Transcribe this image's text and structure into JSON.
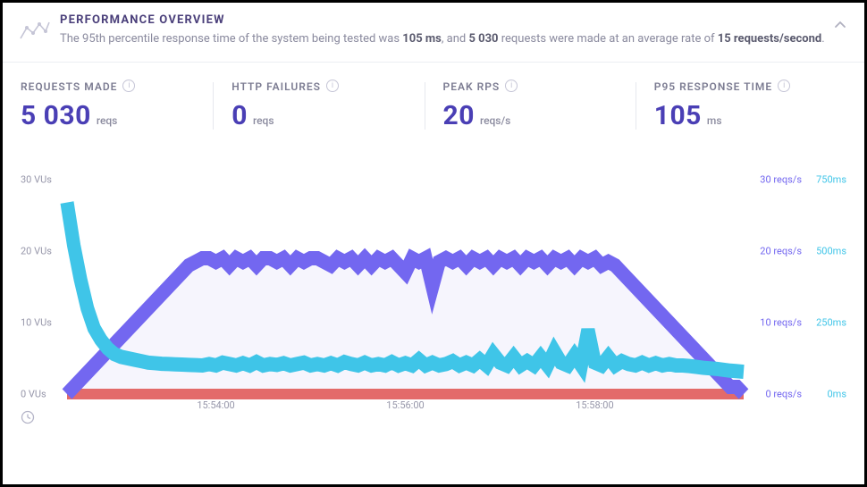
{
  "header": {
    "title": "PERFORMANCE OVERVIEW",
    "sub_prefix": "The 95th percentile response time of the system being tested was ",
    "p95": "105 ms",
    "sub_mid1": ", and ",
    "total_req": "5 030",
    "sub_mid2": " requests were made at an average rate of ",
    "avg_rate": "15 requests/second",
    "sub_suffix": "."
  },
  "metrics": {
    "requests_made": {
      "label": "REQUESTS MADE",
      "value": "5 030",
      "unit": "reqs"
    },
    "http_failures": {
      "label": "HTTP FAILURES",
      "value": "0",
      "unit": "reqs"
    },
    "peak_rps": {
      "label": "PEAK RPS",
      "value": "20",
      "unit": "reqs/s"
    },
    "p95": {
      "label": "P95 RESPONSE TIME",
      "value": "105",
      "unit": "ms"
    }
  },
  "axes": {
    "left": {
      "t0": "0 VUs",
      "t10": "10 VUs",
      "t20": "20 VUs",
      "t30": "30 VUs"
    },
    "right_reqs": {
      "t0": "0 reqs/s",
      "t10": "10 reqs/s",
      "t20": "20 reqs/s",
      "t30": "30 reqs/s"
    },
    "right_ms": {
      "t0": "0ms",
      "t250": "250ms",
      "t500": "500ms",
      "t750": "750ms"
    },
    "x": {
      "t1": "15:54:00",
      "t2": "15:56:00",
      "t3": "15:58:00"
    }
  },
  "chart_data": {
    "type": "line",
    "title": "PERFORMANCE OVERVIEW",
    "x_label": "time",
    "x_ticks": [
      "15:54:00",
      "15:56:00",
      "15:58:00"
    ],
    "left_axis": {
      "label": "VUs",
      "range": [
        0,
        30
      ],
      "ticks": [
        0,
        10,
        20,
        30
      ]
    },
    "right_axis_1": {
      "label": "reqs/s",
      "range": [
        0,
        30
      ],
      "ticks": [
        0,
        10,
        20,
        30
      ]
    },
    "right_axis_2": {
      "label": "ms",
      "range": [
        0,
        750
      ],
      "ticks": [
        0,
        250,
        500,
        750
      ]
    },
    "x": [
      0,
      1,
      2,
      3,
      4,
      5,
      6,
      7,
      8,
      9,
      10,
      11,
      12,
      13,
      14,
      15,
      16,
      17,
      18,
      19,
      20,
      21,
      22,
      23,
      24,
      25,
      26,
      27,
      28,
      29,
      30,
      31,
      32,
      33,
      34,
      35,
      36,
      37,
      38,
      39,
      40,
      41,
      42,
      43,
      44,
      45,
      46,
      47,
      48,
      49,
      50,
      51,
      52,
      53,
      54,
      55,
      56,
      57,
      58,
      59,
      60,
      61,
      62,
      63,
      64,
      65,
      66,
      67,
      68,
      69,
      70,
      71,
      72,
      73,
      74,
      75,
      76,
      77,
      78,
      79,
      80,
      81,
      82,
      83,
      84,
      85,
      86,
      87,
      88,
      89,
      90,
      91,
      92,
      93,
      94,
      95,
      96,
      97,
      98,
      99,
      100
    ],
    "series": [
      {
        "name": "VUs / reqs/s",
        "color": "#7367f0",
        "axis": "left",
        "values": [
          0,
          1,
          2,
          3,
          4,
          5,
          6,
          7,
          8,
          9,
          10,
          11,
          12,
          13,
          14,
          15,
          16,
          17,
          18,
          18.5,
          19,
          19,
          18.5,
          19,
          18,
          19,
          18.5,
          19,
          18,
          19,
          19,
          18.5,
          19,
          18,
          19,
          18.5,
          19,
          19,
          18.5,
          18,
          19,
          18.5,
          19,
          18,
          19,
          18,
          19,
          18.5,
          19,
          18,
          17,
          19,
          18.5,
          19,
          15,
          18.5,
          19,
          18.5,
          19,
          18,
          19,
          18.5,
          19,
          18,
          19,
          18.5,
          19,
          18,
          19,
          18.5,
          19,
          18,
          19,
          18.5,
          19,
          18,
          19,
          18.5,
          19,
          18,
          18.5,
          18,
          17,
          16,
          15,
          14,
          13,
          12,
          11,
          10,
          9,
          8,
          7,
          6,
          5,
          4,
          3,
          2,
          1,
          1,
          0
        ]
      },
      {
        "name": "Response time (ms)",
        "color": "#3fc5e8",
        "axis": "right_ms",
        "values": [
          670,
          520,
          400,
          300,
          230,
          190,
          160,
          140,
          130,
          125,
          120,
          115,
          110,
          108,
          106,
          105,
          104,
          103,
          102,
          101,
          100,
          105,
          100,
          110,
          105,
          100,
          108,
          100,
          112,
          100,
          105,
          102,
          108,
          100,
          105,
          110,
          100,
          105,
          100,
          108,
          100,
          112,
          105,
          100,
          110,
          100,
          105,
          100,
          112,
          100,
          108,
          100,
          120,
          100,
          110,
          100,
          105,
          115,
          100,
          110,
          100,
          120,
          100,
          140,
          110,
          100,
          130,
          100,
          115,
          100,
          130,
          100,
          150,
          110,
          100,
          135,
          100,
          225,
          110,
          100,
          130,
          100,
          115,
          105,
          100,
          110,
          100,
          108,
          100,
          105,
          100,
          100,
          98,
          95,
          92,
          90,
          88,
          85,
          82,
          80,
          78
        ]
      },
      {
        "name": "HTTP failures",
        "color": "#e36a6a",
        "axis": "left",
        "values": [
          0,
          0,
          0,
          0,
          0,
          0,
          0,
          0,
          0,
          0,
          0,
          0,
          0,
          0,
          0,
          0,
          0,
          0,
          0,
          0,
          0,
          0,
          0,
          0,
          0,
          0,
          0,
          0,
          0,
          0,
          0,
          0,
          0,
          0,
          0,
          0,
          0,
          0,
          0,
          0,
          0,
          0,
          0,
          0,
          0,
          0,
          0,
          0,
          0,
          0,
          0,
          0,
          0,
          0,
          0,
          0,
          0,
          0,
          0,
          0,
          0,
          0,
          0,
          0,
          0,
          0,
          0,
          0,
          0,
          0,
          0,
          0,
          0,
          0,
          0,
          0,
          0,
          0,
          0,
          0,
          0,
          0,
          0,
          0,
          0,
          0,
          0,
          0,
          0,
          0,
          0,
          0,
          0,
          0,
          0,
          0,
          0,
          0,
          0,
          0,
          0
        ]
      }
    ]
  }
}
